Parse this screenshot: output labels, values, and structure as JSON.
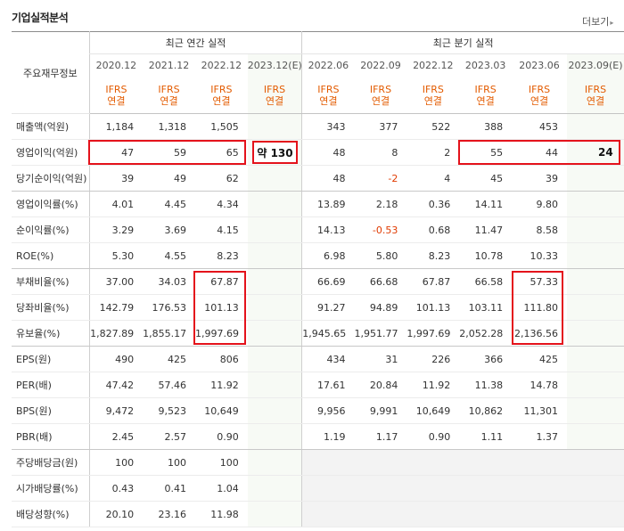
{
  "title": "기업실적분석",
  "more_label": "더보기",
  "label_header": "주요재무정보",
  "groups": {
    "annual": "최근 연간 실적",
    "quarterly": "최근 분기 실적"
  },
  "annual_dates": [
    "2020.12",
    "2021.12",
    "2022.12",
    "2023.12(E)"
  ],
  "quarter_dates": [
    "2022.06",
    "2022.09",
    "2022.12",
    "2023.03",
    "2023.06",
    "2023.09(E)"
  ],
  "ifrs_line1": "IFRS",
  "ifrs_line2": "연결",
  "rows": [
    {
      "label": "매출액(억원)",
      "annual": [
        "1,184",
        "1,318",
        "1,505",
        ""
      ],
      "quarterly": [
        "343",
        "377",
        "522",
        "388",
        "453",
        ""
      ]
    },
    {
      "label": "영업이익(억원)",
      "annual": [
        "47",
        "59",
        "65",
        ""
      ],
      "quarterly": [
        "48",
        "8",
        "2",
        "55",
        "44",
        ""
      ]
    },
    {
      "label": "당기순이익(억원)",
      "annual": [
        "39",
        "49",
        "62",
        ""
      ],
      "quarterly": [
        "48",
        "-2",
        "4",
        "45",
        "39",
        ""
      ]
    },
    {
      "label": "영업이익률(%)",
      "annual": [
        "4.01",
        "4.45",
        "4.34",
        ""
      ],
      "quarterly": [
        "13.89",
        "2.18",
        "0.36",
        "14.11",
        "9.80",
        ""
      ]
    },
    {
      "label": "순이익률(%)",
      "annual": [
        "3.29",
        "3.69",
        "4.15",
        ""
      ],
      "quarterly": [
        "14.13",
        "-0.53",
        "0.68",
        "11.47",
        "8.58",
        ""
      ]
    },
    {
      "label": "ROE(%)",
      "annual": [
        "5.30",
        "4.55",
        "8.23",
        ""
      ],
      "quarterly": [
        "6.98",
        "5.80",
        "8.23",
        "10.78",
        "10.33",
        ""
      ]
    },
    {
      "label": "부채비율(%)",
      "annual": [
        "37.00",
        "34.03",
        "67.87",
        ""
      ],
      "quarterly": [
        "66.69",
        "66.68",
        "67.87",
        "66.58",
        "57.33",
        ""
      ]
    },
    {
      "label": "당좌비율(%)",
      "annual": [
        "142.79",
        "176.53",
        "101.13",
        ""
      ],
      "quarterly": [
        "91.27",
        "94.89",
        "101.13",
        "103.11",
        "111.80",
        ""
      ]
    },
    {
      "label": "유보율(%)",
      "annual": [
        "1,827.89",
        "1,855.17",
        "1,997.69",
        ""
      ],
      "quarterly": [
        "1,945.65",
        "1,951.77",
        "1,997.69",
        "2,052.28",
        "2,136.56",
        ""
      ]
    },
    {
      "label": "EPS(원)",
      "annual": [
        "490",
        "425",
        "806",
        ""
      ],
      "quarterly": [
        "434",
        "31",
        "226",
        "366",
        "425",
        ""
      ]
    },
    {
      "label": "PER(배)",
      "annual": [
        "47.42",
        "57.46",
        "11.92",
        ""
      ],
      "quarterly": [
        "17.61",
        "20.84",
        "11.92",
        "11.38",
        "14.78",
        ""
      ]
    },
    {
      "label": "BPS(원)",
      "annual": [
        "9,472",
        "9,523",
        "10,649",
        ""
      ],
      "quarterly": [
        "9,956",
        "9,991",
        "10,649",
        "10,862",
        "11,301",
        ""
      ]
    },
    {
      "label": "PBR(배)",
      "annual": [
        "2.45",
        "2.57",
        "0.90",
        ""
      ],
      "quarterly": [
        "1.19",
        "1.17",
        "0.90",
        "1.11",
        "1.37",
        ""
      ]
    },
    {
      "label": "주당배당금(원)",
      "annual": [
        "100",
        "100",
        "100",
        ""
      ],
      "quarterly": [
        "",
        "",
        "",
        "",
        "",
        ""
      ]
    },
    {
      "label": "시가배당률(%)",
      "annual": [
        "0.43",
        "0.41",
        "1.04",
        ""
      ],
      "quarterly": [
        "",
        "",
        "",
        "",
        "",
        ""
      ]
    },
    {
      "label": "배당성향(%)",
      "annual": [
        "20.10",
        "23.16",
        "11.98",
        ""
      ],
      "quarterly": [
        "",
        "",
        "",
        "",
        "",
        ""
      ]
    }
  ],
  "annotations": {
    "annual_op_estimate": "약 130",
    "quarter_op_estimate": "24"
  },
  "colors": {
    "ifrs": "#e35b00",
    "highlight_box": "#e4121b",
    "negative": "#e03a00"
  }
}
